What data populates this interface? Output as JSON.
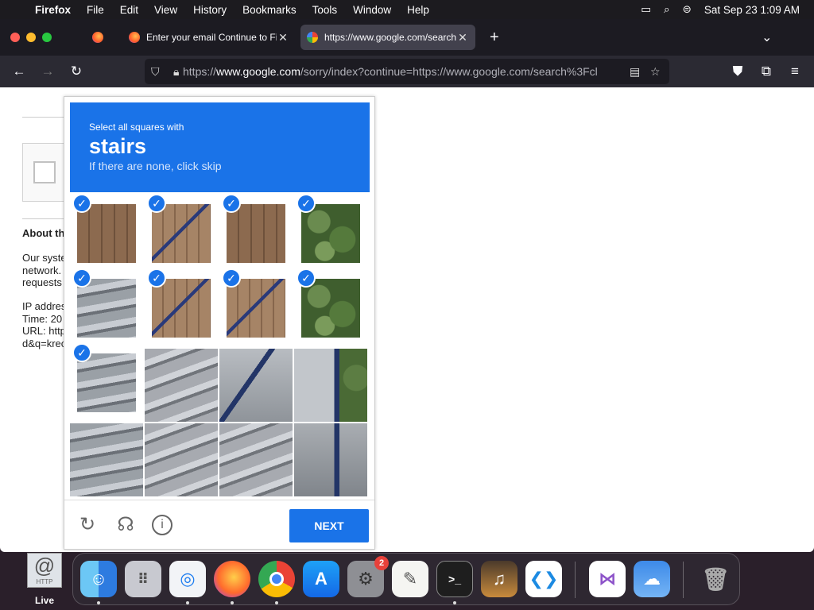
{
  "menubar": {
    "app_name": "Firefox",
    "items": [
      "File",
      "Edit",
      "View",
      "History",
      "Bookmarks",
      "Tools",
      "Window",
      "Help"
    ],
    "datetime": "Sat Sep 23  1:09 AM"
  },
  "tabs": [
    {
      "title": "Enter your email Continue to Fir",
      "favicon": "firefox-icon"
    },
    {
      "title": "https://www.google.com/search",
      "favicon": "google-icon"
    }
  ],
  "address_bar": {
    "url_prefix": "https://",
    "url_domain": "www.google.com",
    "url_rest": "/sorry/index?continue=https://www.google.com/search%3Fcl"
  },
  "page": {
    "about_heading": "About th",
    "para_lines": [
      "Our syste",
      "network.",
      "requests"
    ],
    "info_lines": [
      "IP addres",
      "Time: 20",
      "URL: http",
      "d&q=krec"
    ]
  },
  "captcha": {
    "instruction": "Select all squares with",
    "keyword": "stairs",
    "hint": "If there are none, click skip",
    "next_label": "NEXT",
    "tiles": [
      {
        "pattern": "fence",
        "selected": true
      },
      {
        "pattern": "fence2",
        "selected": true
      },
      {
        "pattern": "fence",
        "selected": true
      },
      {
        "pattern": "plant",
        "selected": true
      },
      {
        "pattern": "stairs",
        "selected": true
      },
      {
        "pattern": "fence2",
        "selected": true
      },
      {
        "pattern": "fence2",
        "selected": true
      },
      {
        "pattern": "plant",
        "selected": true
      },
      {
        "pattern": "stairs",
        "selected": true
      },
      {
        "pattern": "stairs2",
        "selected": false
      },
      {
        "pattern": "rail",
        "selected": false
      },
      {
        "pattern": "railplant",
        "selected": false
      },
      {
        "pattern": "stairs",
        "selected": false
      },
      {
        "pattern": "stairs2",
        "selected": false
      },
      {
        "pattern": "stairs2",
        "selected": false
      },
      {
        "pattern": "railv",
        "selected": false
      }
    ]
  },
  "dock": {
    "desktop_icon_label": "Live",
    "desktop_icon_text": "HTTP",
    "settings_badge": "2",
    "apps": [
      "finder-icon",
      "launchpad-icon",
      "safari-icon",
      "firefox-icon",
      "chrome-icon",
      "app-store-icon",
      "system-settings-icon",
      "textedit-icon",
      "terminal-icon",
      "garageband-icon",
      "vscode-icon",
      "visual-studio-icon",
      "weather-icon",
      "trash-icon"
    ]
  },
  "colors": {
    "accent": "#1a73e8"
  }
}
